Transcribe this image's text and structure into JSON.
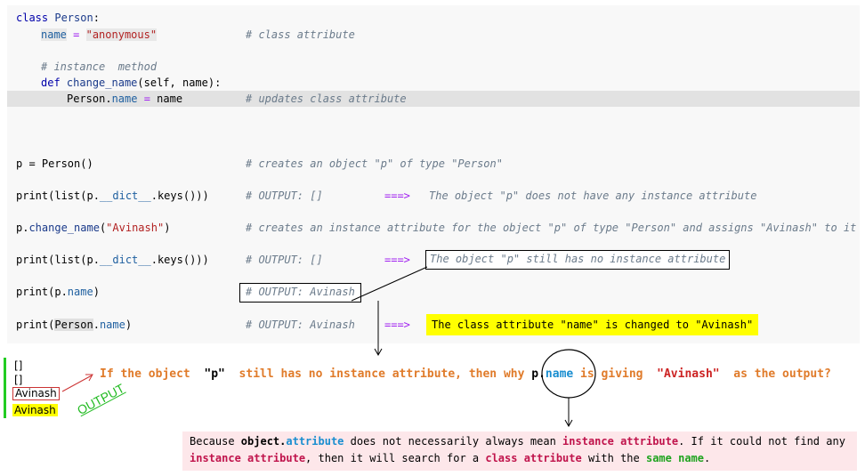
{
  "code": {
    "line1": {
      "kw": "class",
      "name": "Person",
      "colon": ":"
    },
    "line2": {
      "attr": "name",
      "eq": " = ",
      "str": "\"anonymous\"",
      "comment": "# class attribute"
    },
    "line3": {
      "comment": "# instance  method"
    },
    "line4": {
      "kw": "def",
      "fn": "change_name",
      "args": "(self, name):"
    },
    "line5": {
      "obj": "Person.",
      "attr": "name",
      "eq": " = ",
      "val": "name",
      "comment": "# updates class attribute"
    },
    "line6": {
      "code": "p = Person()",
      "comment": "# creates an object \"p\" of type \"Person\""
    },
    "line7": {
      "code_a": "print(list(p.",
      "dict": "__dict__",
      "code_b": ".keys()))",
      "comment": "# OUTPUT: []",
      "arrow": "===>",
      "note": "The object \"p\" does not have any instance attribute"
    },
    "line8": {
      "code_a": "p.",
      "fn": "change_name",
      "code_b": "(",
      "str": "\"Avinash\"",
      "code_c": ")",
      "comment": "# creates an instance attribute for the object \"p\" of type \"Person\" and assigns \"Avinash\" to it"
    },
    "line9": {
      "code_a": "print(list(p.",
      "dict": "__dict__",
      "code_b": ".keys()))",
      "comment": "# OUTPUT: []",
      "arrow": "===>",
      "note": "The object \"p\" still has no instance attribute"
    },
    "line10": {
      "code_a": "print(p.",
      "attr": "name",
      "code_b": ")",
      "comment": "# OUTPUT: Avinash"
    },
    "line11": {
      "code_a": "print(",
      "obj": "Person",
      "dot": ".",
      "attr": "name",
      "code_b": ")",
      "comment": "# OUTPUT: Avinash",
      "arrow": "===>",
      "note": "The class attribute \"name\" is changed to \"Avinash\""
    }
  },
  "output": {
    "lines": [
      "[]",
      "[]",
      "Avinash",
      "Avinash"
    ],
    "label": "OUTPUT"
  },
  "question": {
    "a": "If the object  ",
    "p": "\"p\"",
    "b": "  still has no instance attribute, then why ",
    "pname_obj": "p.",
    "pname_attr": "name",
    "c": " is giving  ",
    "avinash": "\"Avinash\"",
    "d": "  as the output?"
  },
  "explanation": {
    "t1": "Because ",
    "obj": "object.",
    "attr": "attribute",
    "t2": " does not necessarily always mean ",
    "ia1": "instance attribute",
    "t3": ". If it could not find any ",
    "ia2": "instance attribute",
    "t4": ", then it will search for a ",
    "ca": "class attribute",
    "t5": " with the ",
    "sn": "same name",
    "t6": "."
  },
  "colors": {
    "code_bg": "#f8f8f8",
    "highlight": "#e2e2e2",
    "comment": "#6b7b8b",
    "question": "#e07b2a",
    "explain_bg": "#fde7ea",
    "output_bar": "#22cc22",
    "note_highlight": "#ffff00"
  }
}
